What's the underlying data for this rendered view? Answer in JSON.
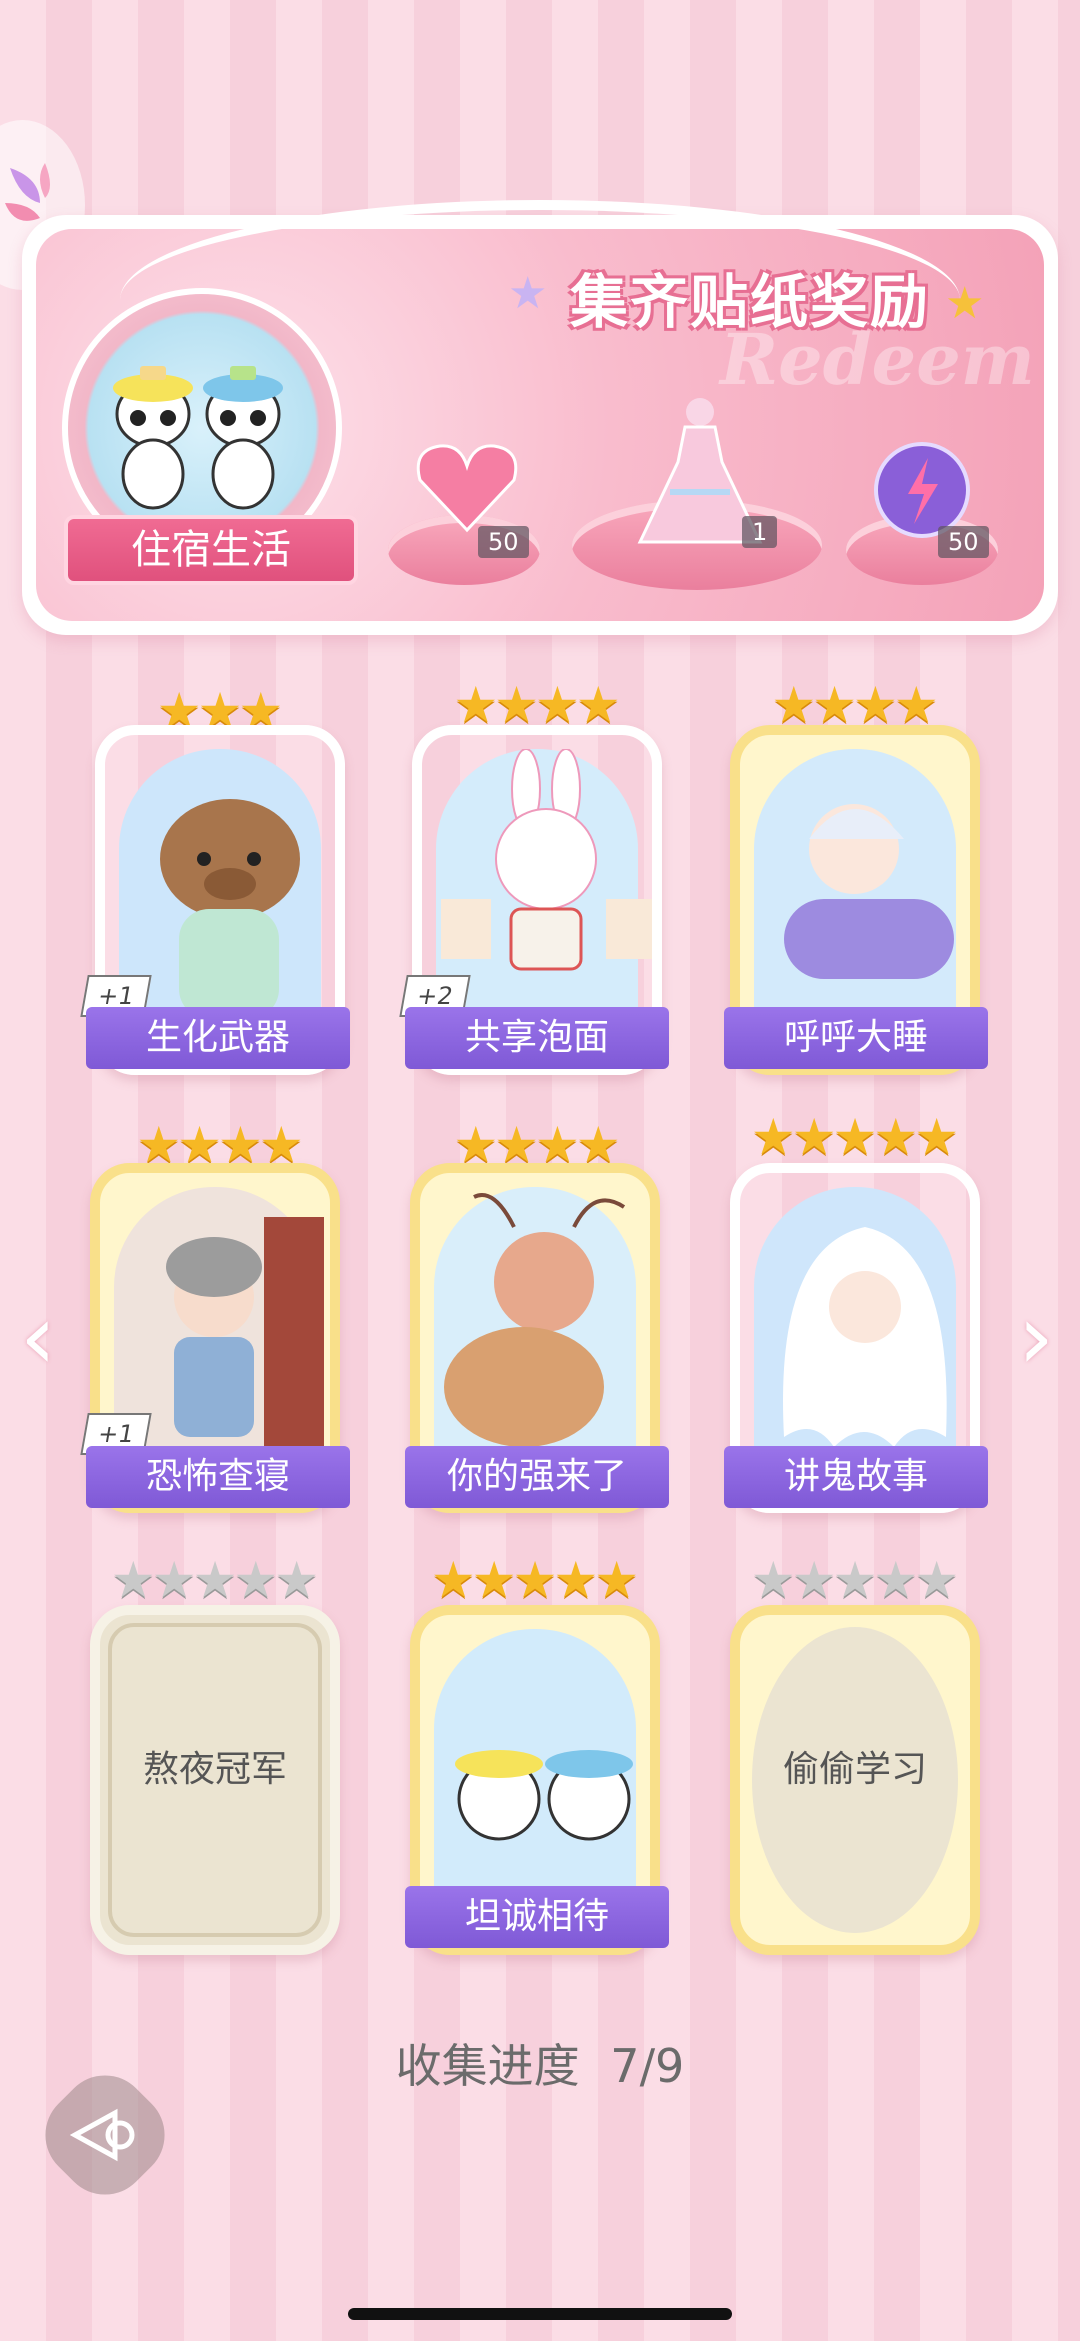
{
  "banner": {
    "title": "集齐贴纸奖励",
    "watermark": "Redeem",
    "collection_name": "住宿生活",
    "rewards": [
      {
        "name": "heart-gem",
        "count": "50"
      },
      {
        "name": "dress",
        "count": "1"
      },
      {
        "name": "energy-orb",
        "count": "50"
      }
    ]
  },
  "stickers": [
    {
      "title": "生化武器",
      "stars": 3,
      "plus": "+1",
      "frame": "white",
      "collected": true
    },
    {
      "title": "共享泡面",
      "stars": 4,
      "plus": "+2",
      "frame": "white",
      "collected": true
    },
    {
      "title": "呼呼大睡",
      "stars": 4,
      "plus": "",
      "frame": "gold",
      "collected": true
    },
    {
      "title": "恐怖查寝",
      "stars": 4,
      "plus": "+1",
      "frame": "gold",
      "collected": true
    },
    {
      "title": "你的强来了",
      "stars": 4,
      "plus": "",
      "frame": "gold",
      "collected": true
    },
    {
      "title": "讲鬼故事",
      "stars": 5,
      "plus": "",
      "frame": "white",
      "collected": true
    },
    {
      "title": "熬夜冠军",
      "stars": 5,
      "plus": "",
      "frame": "white",
      "collected": false
    },
    {
      "title": "坦诚相待",
      "stars": 5,
      "plus": "",
      "frame": "gold",
      "collected": true
    },
    {
      "title": "偷偷学习",
      "stars": 5,
      "plus": "",
      "frame": "gold",
      "collected": false
    }
  ],
  "progress": {
    "label": "收集进度",
    "value": "7/9"
  },
  "colors": {
    "accent": "#8a63e0",
    "pink": "#f06b93",
    "gold_star": "#f6b824"
  }
}
